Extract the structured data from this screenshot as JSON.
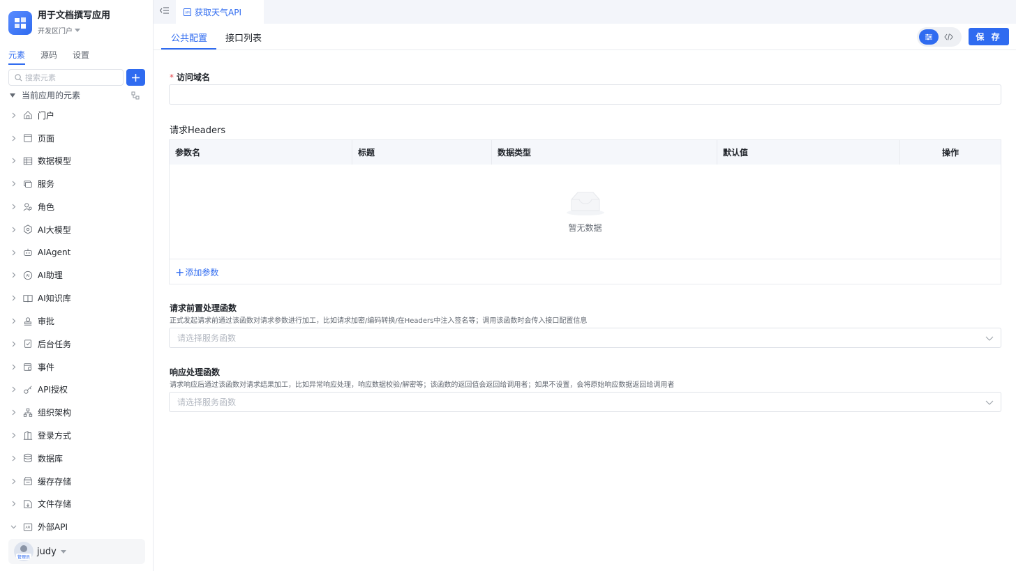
{
  "app": {
    "name": "用于文档撰写应用",
    "portal": "开发区门户"
  },
  "side_tabs": [
    "元素",
    "源码",
    "设置"
  ],
  "search": {
    "placeholder": "搜索元素"
  },
  "tree_root": "当前应用的元素",
  "tree_items": [
    {
      "label": "门户",
      "icon": "home-icon"
    },
    {
      "label": "页面",
      "icon": "page-icon"
    },
    {
      "label": "数据模型",
      "icon": "table-icon"
    },
    {
      "label": "服务",
      "icon": "service-icon"
    },
    {
      "label": "角色",
      "icon": "role-icon"
    },
    {
      "label": "AI大模型",
      "icon": "ai-model-icon"
    },
    {
      "label": "AIAgent",
      "icon": "robot-icon"
    },
    {
      "label": "AI助理",
      "icon": "ai-assistant-icon"
    },
    {
      "label": "AI知识库",
      "icon": "book-icon"
    },
    {
      "label": "审批",
      "icon": "approval-icon"
    },
    {
      "label": "后台任务",
      "icon": "task-icon"
    },
    {
      "label": "事件",
      "icon": "event-icon"
    },
    {
      "label": "API授权",
      "icon": "key-icon"
    },
    {
      "label": "组织架构",
      "icon": "org-icon"
    },
    {
      "label": "登录方式",
      "icon": "login-icon"
    },
    {
      "label": "数据库",
      "icon": "database-icon"
    },
    {
      "label": "缓存存储",
      "icon": "cache-icon"
    },
    {
      "label": "文件存储",
      "icon": "file-storage-icon"
    },
    {
      "label": "外部API",
      "icon": "api-icon",
      "expanded": true
    }
  ],
  "user": {
    "name": "judy",
    "role_badge": "管理员"
  },
  "open_tab": {
    "label": "获取天气API"
  },
  "content_tabs": [
    "公共配置",
    "接口列表"
  ],
  "save_label": "保 存",
  "form": {
    "domain": {
      "label": "访问域名",
      "value": ""
    },
    "headers": {
      "label": "请求Headers",
      "columns": [
        "参数名",
        "标题",
        "数据类型",
        "默认值",
        "操作"
      ],
      "empty_text": "暂无数据",
      "add_label": "添加参数"
    },
    "pre_handler": {
      "label": "请求前置处理函数",
      "desc": "正式发起请求前通过该函数对请求参数进行加工，比如请求加密/编码转换/在Headers中注入签名等；调用该函数时会传入接口配置信息",
      "placeholder": "请选择服务函数"
    },
    "resp_handler": {
      "label": "响应处理函数",
      "desc": "请求响应后通过该函数对请求结果加工，比如异常响应处理，响应数据校验/解密等；该函数的返回值会返回给调用者；如果不设置，会将原始响应数据返回给调用者",
      "placeholder": "请选择服务函数"
    }
  },
  "colors": {
    "accent": "#2f6bf0",
    "required": "#e5484d"
  }
}
